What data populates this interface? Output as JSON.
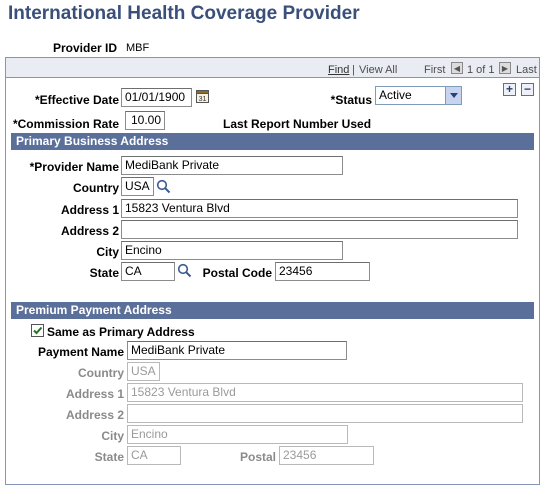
{
  "page_title": "International Health Coverage Provider",
  "provider_id": {
    "label": "Provider ID",
    "value": "MBF"
  },
  "nav": {
    "find": "Find",
    "sep": "|",
    "view_all": "View All",
    "first": "First",
    "counter": "1 of 1",
    "last": "Last"
  },
  "effective_date": {
    "label": "*Effective Date",
    "value": "01/01/1900"
  },
  "status": {
    "label": "*Status",
    "value": "Active"
  },
  "commission_rate": {
    "label": "*Commission Rate",
    "value": "10.00"
  },
  "last_report": {
    "label": "Last Report Number Used"
  },
  "primary": {
    "header": "Primary Business Address",
    "provider_name": {
      "label": "*Provider Name",
      "value": "MediBank Private"
    },
    "country": {
      "label": "Country",
      "value": "USA"
    },
    "address1": {
      "label": "Address 1",
      "value": "15823 Ventura Blvd"
    },
    "address2": {
      "label": "Address 2",
      "value": ""
    },
    "city": {
      "label": "City",
      "value": "Encino"
    },
    "state": {
      "label": "State",
      "value": "CA"
    },
    "postal": {
      "label": "Postal Code",
      "value": "23456"
    }
  },
  "premium": {
    "header": "Premium Payment Address",
    "same_as_primary": {
      "label": "Same as Primary Address",
      "checked": true
    },
    "payment_name": {
      "label": "Payment Name",
      "value": "MediBank Private"
    },
    "country": {
      "label": "Country",
      "value": "USA"
    },
    "address1": {
      "label": "Address 1",
      "value": "15823 Ventura Blvd"
    },
    "address2": {
      "label": "Address 2",
      "value": ""
    },
    "city": {
      "label": "City",
      "value": "Encino"
    },
    "state": {
      "label": "State",
      "value": "CA"
    },
    "postal": {
      "label": "Postal",
      "value": "23456"
    }
  },
  "colors": {
    "title": "#3a4f7a",
    "section_bar": "#5b6f9b",
    "nav_bar": "#e9ecf3",
    "border": "#8595b5"
  }
}
